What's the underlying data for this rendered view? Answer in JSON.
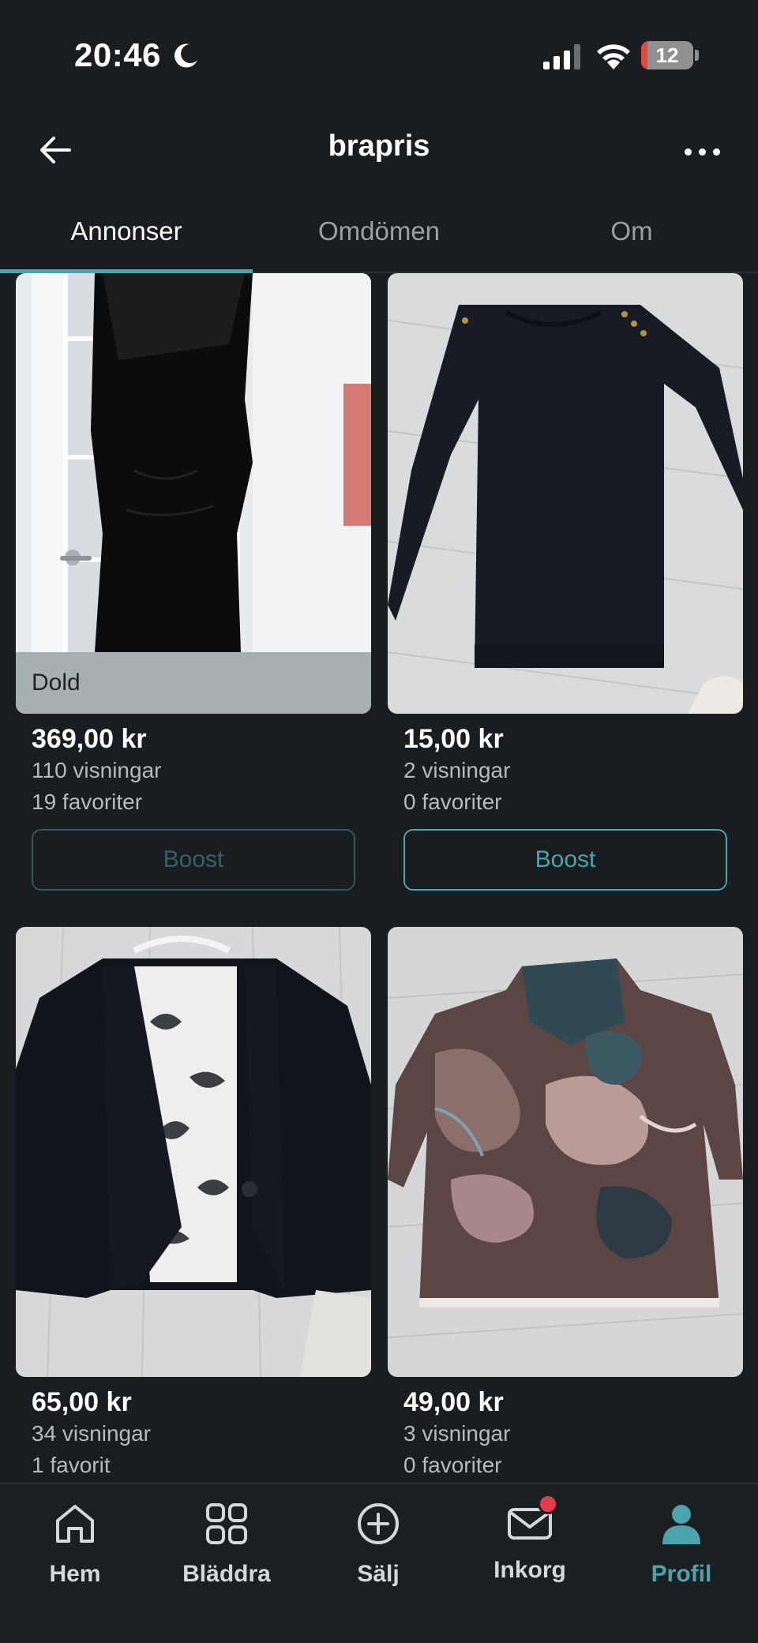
{
  "status": {
    "time": "20:46",
    "battery_level": "12",
    "battery_fraction": 0.12,
    "icons": [
      "moon-icon",
      "signal-icon",
      "wifi-icon",
      "battery-icon"
    ]
  },
  "header": {
    "title": "brapris",
    "back_icon": "arrow-left-icon",
    "more_icon": "more-horizontal-icon"
  },
  "tabs": [
    {
      "label": "Annonser",
      "active": true
    },
    {
      "label": "Omdömen",
      "active": false
    },
    {
      "label": "Om",
      "active": false
    }
  ],
  "listings": [
    {
      "price": "369,00 kr",
      "views": "110 visningar",
      "favorites": "19 favoriter",
      "hidden_label": "Dold",
      "boost_label": "Boost",
      "image": "black-dress-photo"
    },
    {
      "price": "15,00 kr",
      "views": "2 visningar",
      "favorites": "0 favoriter",
      "boost_label": "Boost",
      "image": "navy-sweater-photo"
    },
    {
      "price": "65,00 kr",
      "views": "34 visningar",
      "favorites": "1 favorit",
      "image": "black-blazer-photo"
    },
    {
      "price": "49,00 kr",
      "views": "3 visningar",
      "favorites": "0 favoriter",
      "image": "marble-print-top-photo"
    }
  ],
  "nav": [
    {
      "label": "Hem",
      "icon": "home-icon"
    },
    {
      "label": "Bläddra",
      "icon": "grid-icon"
    },
    {
      "label": "Sälj",
      "icon": "plus-circle-icon"
    },
    {
      "label": "Inkorg",
      "icon": "mail-icon",
      "badge": true
    },
    {
      "label": "Profil",
      "icon": "profile-icon",
      "active": true
    }
  ],
  "colors": {
    "accent": "#4aa3ad",
    "background": "#1a1d1f",
    "badge": "#e63b4a",
    "battery_low": "#e8453c"
  }
}
